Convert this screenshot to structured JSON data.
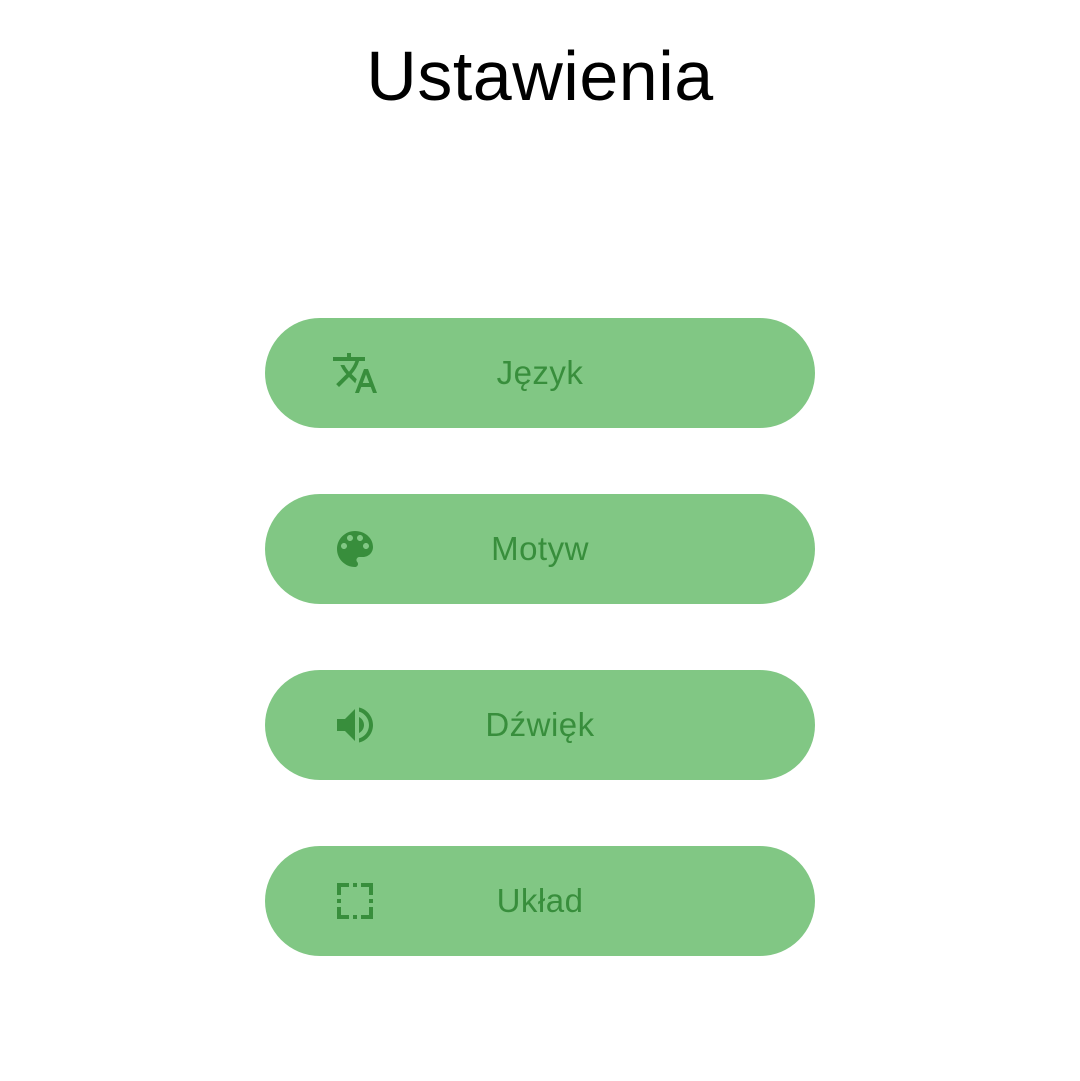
{
  "screen": {
    "title": "Ustawienia"
  },
  "menu": {
    "items": [
      {
        "label": "Język",
        "icon": "translate-icon"
      },
      {
        "label": "Motyw",
        "icon": "palette-icon"
      },
      {
        "label": "Dźwięk",
        "icon": "volume-icon"
      },
      {
        "label": "Układ",
        "icon": "fullscreen-frame-icon"
      }
    ]
  },
  "colors": {
    "background": "#ffffff",
    "title": "#000000",
    "button_background": "#81c784",
    "button_foreground": "#388e3c"
  }
}
